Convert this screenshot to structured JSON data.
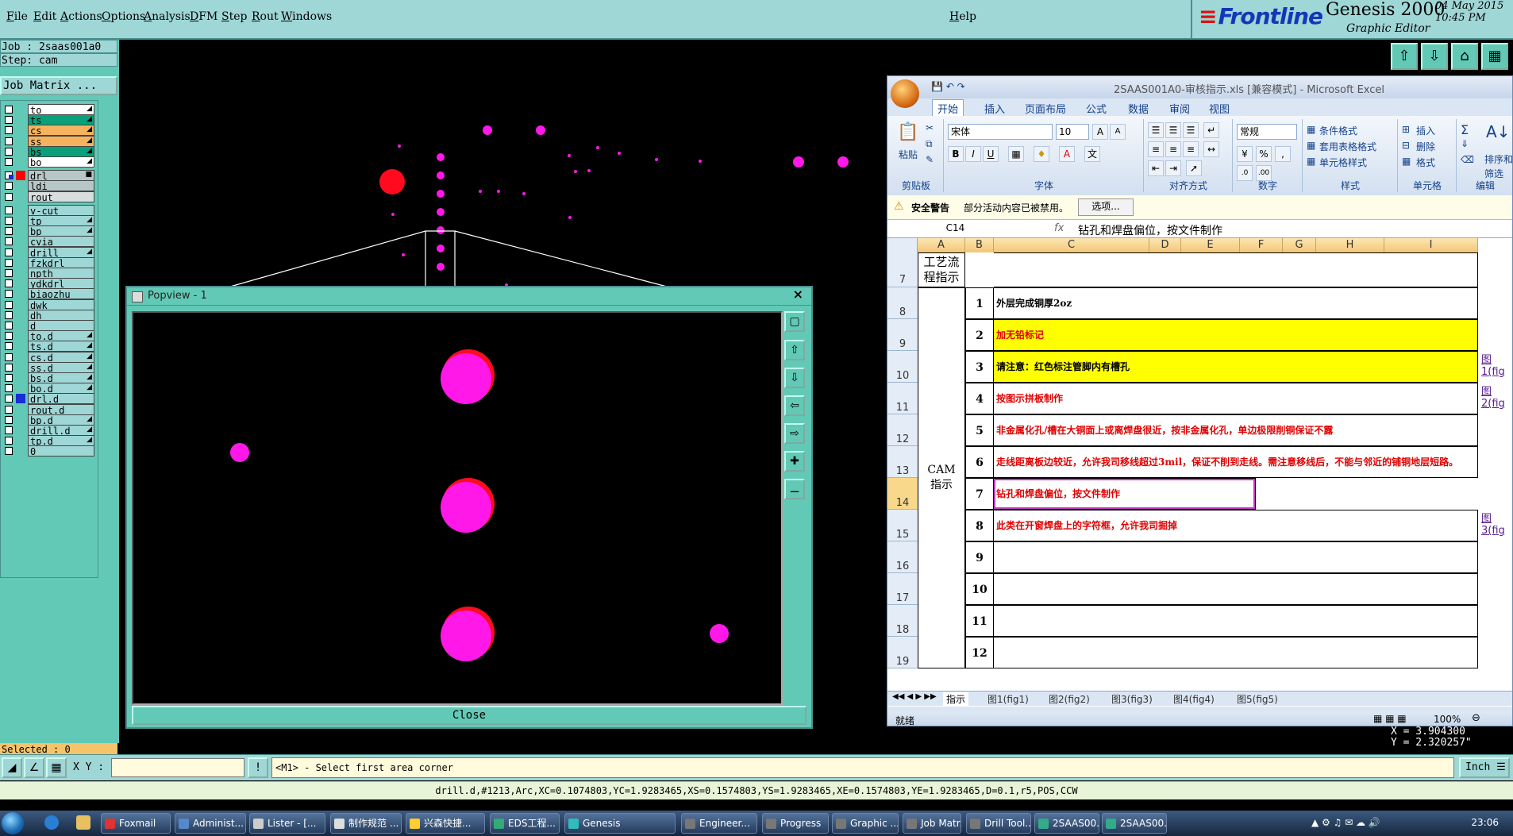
{
  "menu": {
    "items": [
      "File",
      "Edit",
      "Actions",
      "Options",
      "Analysis",
      "DFM",
      "Step",
      "Rout",
      "Windows"
    ],
    "help": "Help"
  },
  "brand": {
    "logo": "Frontline",
    "product": "Genesis 2000",
    "subtitle": "Graphic Editor",
    "date": "04 May 2015",
    "time": "10:45 PM"
  },
  "job": {
    "job_line": "Job : 2saas001a0",
    "step_line": "Step: cam",
    "matrix_button": "Job Matrix ..."
  },
  "layers": [
    {
      "name": "to",
      "color": "#ffffff",
      "icon": "◢"
    },
    {
      "name": "ts",
      "color": "#0aa07a",
      "icon": "◢"
    },
    {
      "name": "cs",
      "color": "#f6b35e",
      "icon": "◢"
    },
    {
      "name": "ss",
      "color": "#f6b35e",
      "icon": "◢"
    },
    {
      "name": "bs",
      "color": "#0aa07a",
      "icon": "◢"
    },
    {
      "name": "bo",
      "color": "#ffffff",
      "icon": "◢"
    },
    {
      "name": "drl",
      "color": "#b7c7c7",
      "icon": "■"
    },
    {
      "name": "ldi",
      "color": "#b7c7c7",
      "icon": ""
    },
    {
      "name": "rout",
      "color": "#d8dede",
      "icon": ""
    },
    {
      "name": "v-cut",
      "color": "#9fd6d6",
      "icon": ""
    },
    {
      "name": "tp",
      "color": "#9fd6d6",
      "icon": "◢"
    },
    {
      "name": "bp",
      "color": "#9fd6d6",
      "icon": "◢"
    },
    {
      "name": "cvia",
      "color": "#9fd6d6",
      "icon": ""
    },
    {
      "name": "drill",
      "color": "#9fd6d6",
      "icon": "◢"
    },
    {
      "name": "fzkdrl",
      "color": "#9fd6d6",
      "icon": ""
    },
    {
      "name": "npth",
      "color": "#9fd6d6",
      "icon": ""
    },
    {
      "name": "ydkdrl",
      "color": "#9fd6d6",
      "icon": ""
    },
    {
      "name": "biaozhu",
      "color": "#9fd6d6",
      "icon": ""
    },
    {
      "name": "dwk",
      "color": "#9fd6d6",
      "icon": ""
    },
    {
      "name": "dh",
      "color": "#9fd6d6",
      "icon": ""
    },
    {
      "name": "d",
      "color": "#9fd6d6",
      "icon": ""
    },
    {
      "name": "to.d",
      "color": "#9fd6d6",
      "icon": "◢"
    },
    {
      "name": "ts.d",
      "color": "#9fd6d6",
      "icon": "◢"
    },
    {
      "name": "cs.d",
      "color": "#9fd6d6",
      "icon": "◢"
    },
    {
      "name": "ss.d",
      "color": "#9fd6d6",
      "icon": "◢"
    },
    {
      "name": "bs.d",
      "color": "#9fd6d6",
      "icon": "◢"
    },
    {
      "name": "bo.d",
      "color": "#9fd6d6",
      "icon": "◢"
    },
    {
      "name": "drl.d",
      "color": "#9fd6d6",
      "icon": ""
    },
    {
      "name": "rout.d",
      "color": "#9fd6d6",
      "icon": ""
    },
    {
      "name": "bp.d",
      "color": "#9fd6d6",
      "icon": "◢"
    },
    {
      "name": "drill.d",
      "color": "#9fd6d6",
      "icon": "◢"
    },
    {
      "name": "tp.d",
      "color": "#9fd6d6",
      "icon": "◢"
    },
    {
      "name": "0",
      "color": "#9fd6d6",
      "icon": ""
    }
  ],
  "selected": "Selected : 0",
  "popview": {
    "title": "Popview - 1",
    "close_label": "Close"
  },
  "excel": {
    "title": "2SAAS001A0-审核指示.xls [兼容模式] - Microsoft Excel",
    "tabs": [
      "开始",
      "插入",
      "页面布局",
      "公式",
      "数据",
      "审阅",
      "视图"
    ],
    "groups": {
      "clipboard": "剪贴板",
      "paste": "粘贴",
      "font": "字体",
      "align": "对齐方式",
      "number": "数字",
      "styles": "样式",
      "cells": "单元格",
      "edit": "编辑"
    },
    "font_name": "宋体",
    "font_size": "10",
    "number_format": "常规",
    "style_buttons": [
      "条件格式",
      "套用表格格式",
      "单元格样式"
    ],
    "cell_buttons": [
      "插入",
      "删除",
      "格式"
    ],
    "edit_buttons": [
      "排序和",
      "筛选"
    ],
    "security_title": "安全警告",
    "security_text": "部分活动内容已被禁用。",
    "security_button": "选项...",
    "name_box": "C14",
    "fx": "fx",
    "formula": "钻孔和焊盘偏位，按文件制作",
    "columns": [
      "A",
      "B",
      "C",
      "D",
      "E",
      "F",
      "G",
      "H",
      "I"
    ],
    "section_process": "工艺流程指示",
    "section_cam": "CAM指示",
    "rows": [
      {
        "row": "7",
        "num": "",
        "text": "",
        "style": "plain",
        "fig": ""
      },
      {
        "row": "8",
        "num": "1",
        "text": "外层完成铜厚2oz",
        "style": "black",
        "fig": ""
      },
      {
        "row": "9",
        "num": "2",
        "text": "加无铅标记",
        "style": "yellow-red",
        "fig": ""
      },
      {
        "row": "10",
        "num": "3",
        "text": "请注意：红色标注管脚内有槽孔",
        "style": "yellow-black",
        "fig": "图1(fig"
      },
      {
        "row": "11",
        "num": "4",
        "text": "按图示拼板制作",
        "style": "red",
        "fig": "图2(fig"
      },
      {
        "row": "12",
        "num": "5",
        "text": "非金属化孔/槽在大铜面上或离焊盘很近，按非金属化孔，单边极限削铜保证不露",
        "style": "red",
        "fig": ""
      },
      {
        "row": "13",
        "num": "6",
        "text": "走线距离板边较近，允许我司移线超过3mil，保证不削到走线。需注意移线后，不能与邻近的铺铜地层短路。",
        "style": "red",
        "fig": ""
      },
      {
        "row": "14",
        "num": "7",
        "text": "钻孔和焊盘偏位，按文件制作",
        "style": "red-selected",
        "fig": ""
      },
      {
        "row": "15",
        "num": "8",
        "text": "此类在开窗焊盘上的字符框，允许我司掘掉",
        "style": "red",
        "fig": "图3(fig"
      },
      {
        "row": "16",
        "num": "9",
        "text": "",
        "style": "plain",
        "fig": ""
      },
      {
        "row": "17",
        "num": "10",
        "text": "",
        "style": "plain",
        "fig": ""
      },
      {
        "row": "18",
        "num": "11",
        "text": "",
        "style": "plain",
        "fig": ""
      },
      {
        "row": "19",
        "num": "12",
        "text": "",
        "style": "plain",
        "fig": ""
      }
    ],
    "sheet_tabs": [
      "指示",
      "图1(fig1)",
      "图2(fig2)",
      "图3(fig3)",
      "图4(fig4)",
      "图5(fig5)"
    ],
    "status_left": "就绪",
    "zoom": "100%"
  },
  "coords": {
    "x": "X = 3.904300",
    "y": "Y = 2.320257\""
  },
  "command": {
    "xy_label": "X Y :",
    "xy_value": "",
    "prompt": "<M1> - Select first area corner",
    "units": "Inch"
  },
  "feature_line": "drill.d,#1213,Arc,XC=0.1074803,YC=1.9283465,XS=0.1574803,YS=1.9283465,XE=0.1574803,YE=1.9283465,D=0.1,r5,POS,CCW",
  "taskbar": {
    "buttons": [
      {
        "label": "Foxmail",
        "color": "#d33"
      },
      {
        "label": "Administ...",
        "color": "#58c"
      },
      {
        "label": "Lister - [...",
        "color": "#ccc"
      },
      {
        "label": "制作规范 ...",
        "color": "#ddd"
      },
      {
        "label": "兴森快捷...",
        "color": "#fc3"
      },
      {
        "label": "EDS工程...",
        "color": "#3a7"
      },
      {
        "label": "Genesis",
        "color": "#3bb"
      },
      {
        "label": "Engineer...",
        "color": "#777"
      },
      {
        "label": "Progress",
        "color": "#777"
      },
      {
        "label": "Graphic ...",
        "color": "#777"
      },
      {
        "label": "Job Matr...",
        "color": "#777"
      },
      {
        "label": "Drill Tool...",
        "color": "#777"
      },
      {
        "label": "2SAAS00...",
        "color": "#3a8"
      },
      {
        "label": "2SAAS00...",
        "color": "#3a8"
      }
    ],
    "clock": "23:06"
  }
}
